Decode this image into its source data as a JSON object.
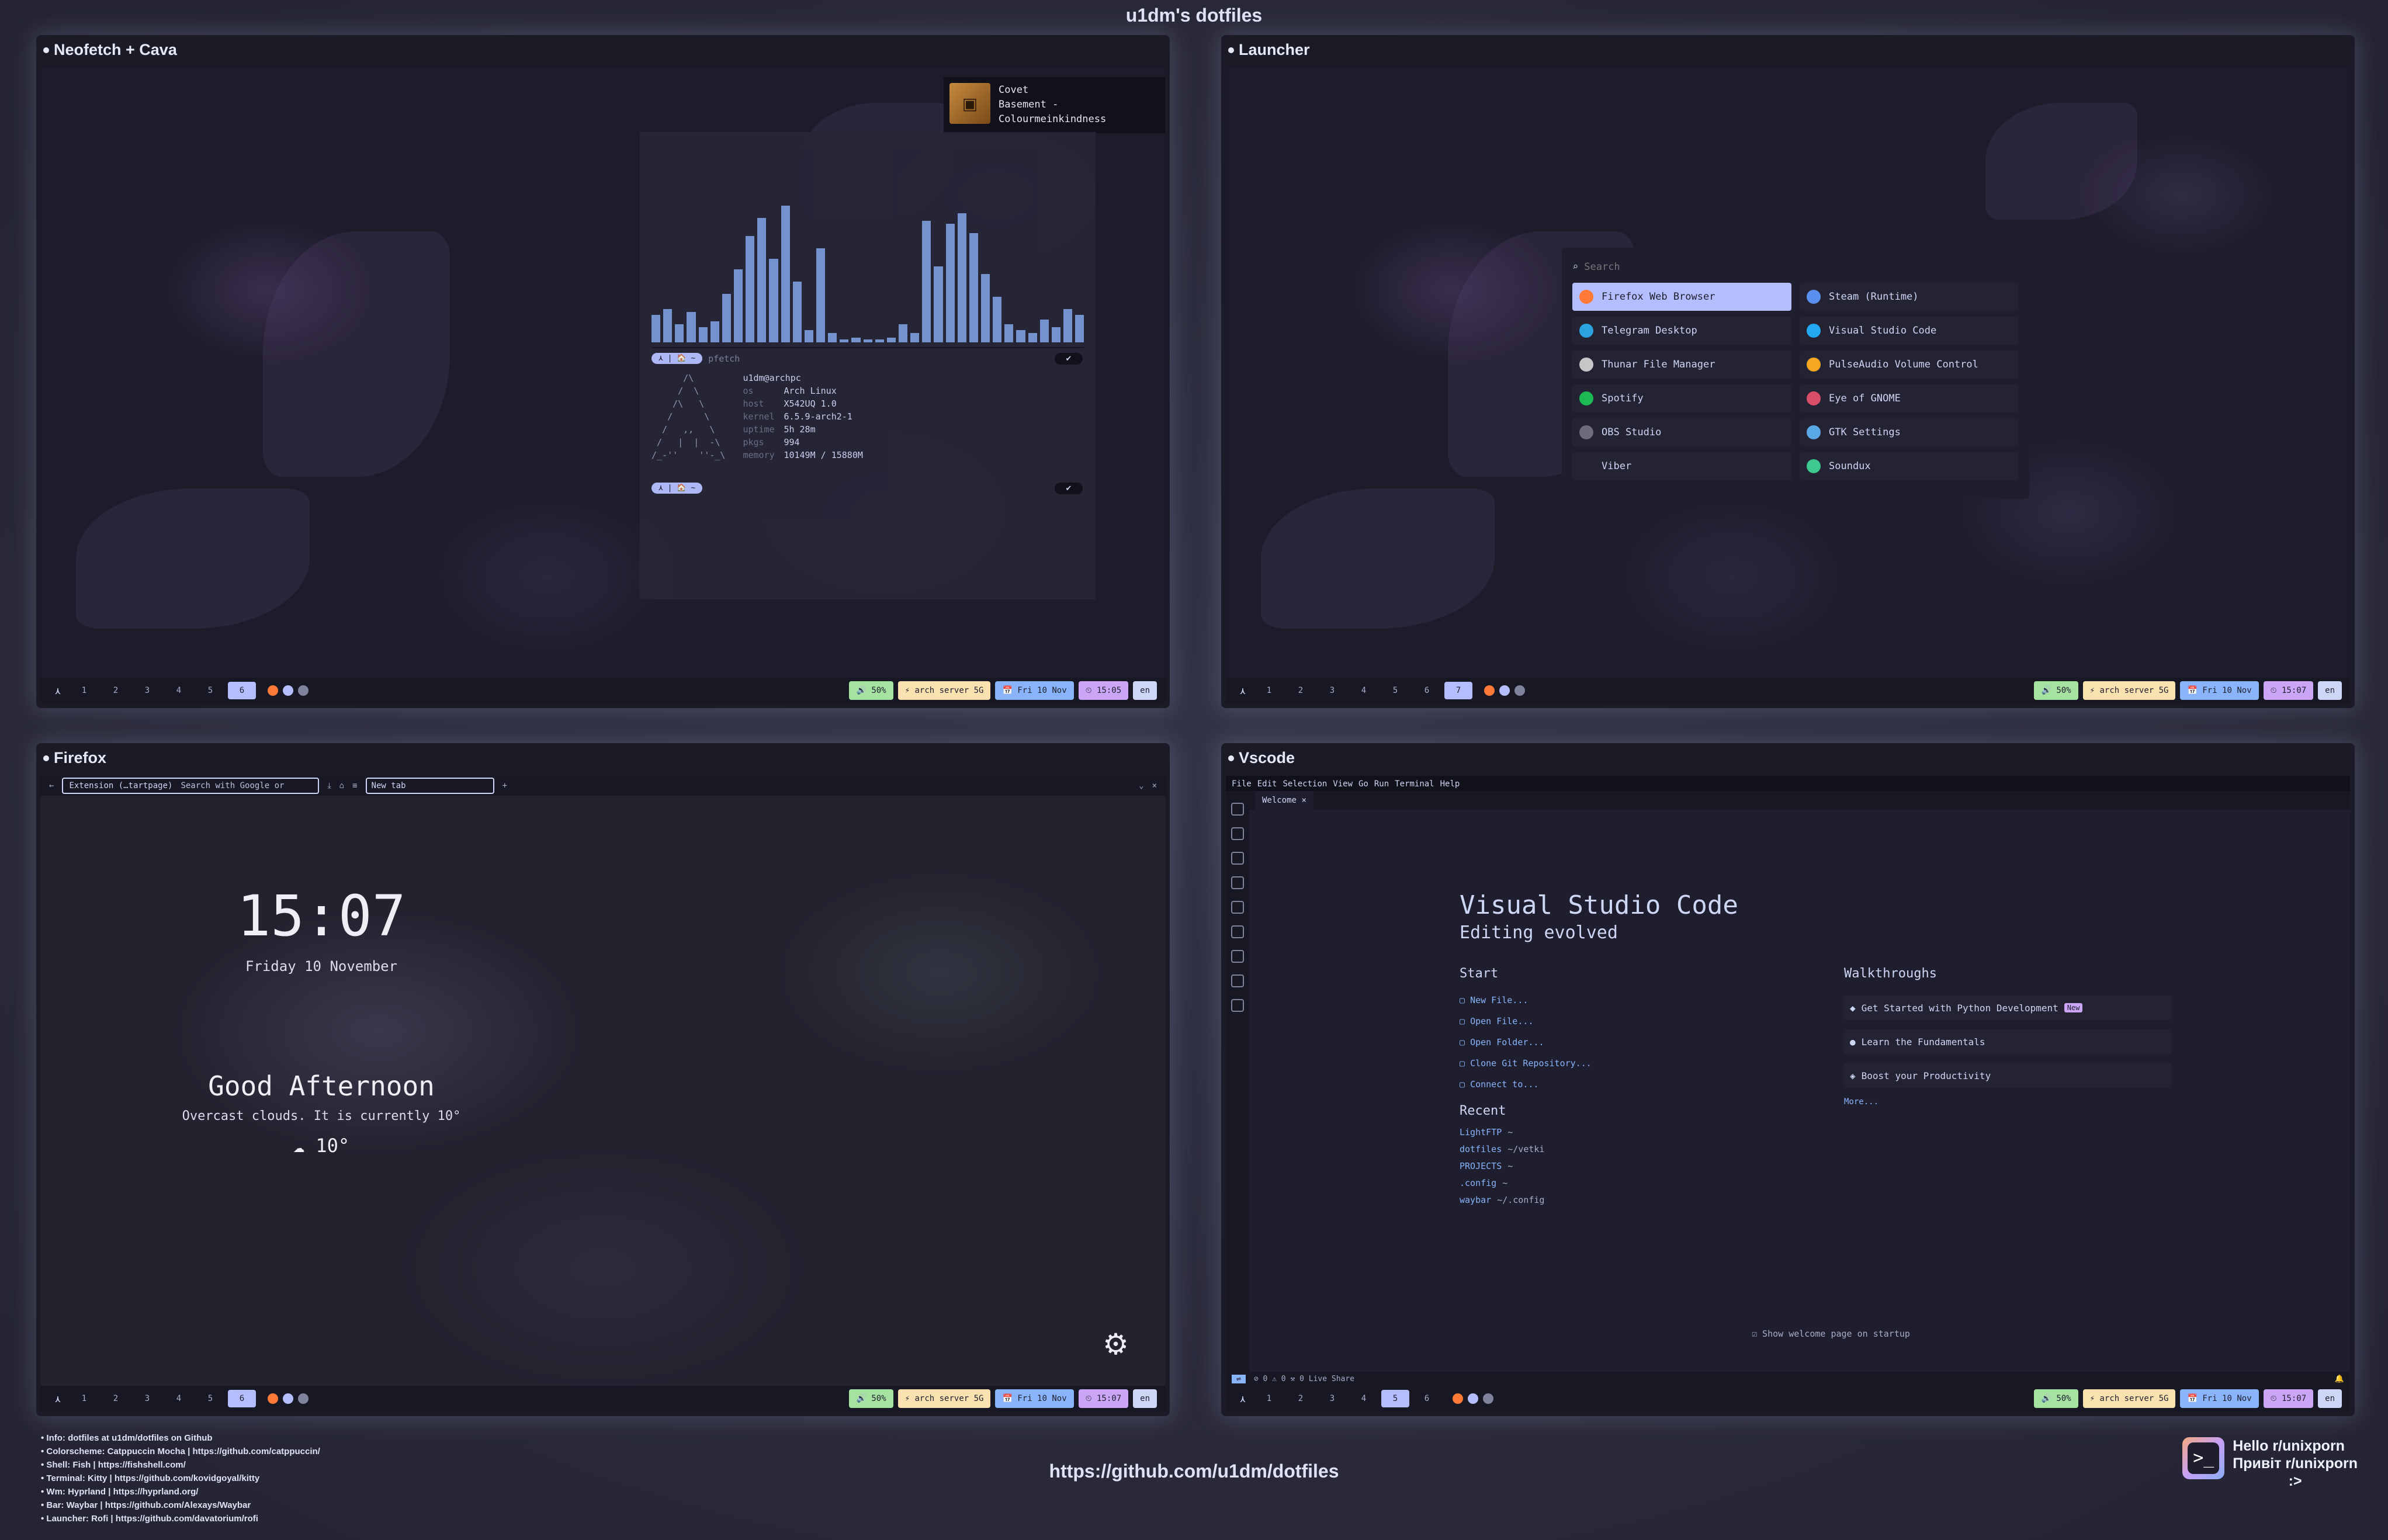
{
  "page_title": "u1dm's dotfiles",
  "bar": {
    "arch_glyph": "⋏",
    "workspaces": [
      "1",
      "2",
      "3",
      "4",
      "5"
    ],
    "ws6": "6",
    "ws7": "7",
    "volume": "🔊 50%",
    "network": "⚡ arch server 5G",
    "date": "📅 Fri 10 Nov",
    "lang": "en"
  },
  "panels": {
    "neofetch": {
      "title": "Neofetch + Cava",
      "clock": "⏲ 15:05",
      "now_playing": {
        "title": "Covet",
        "line2": "Basement -",
        "line3": "Colourmeinkindness"
      },
      "prompt_cmd": "pfetch",
      "prompt_seg": "⋏ | 🏠 ~",
      "check": "✔",
      "fetch": {
        "user": "u1dm@archpc",
        "os_label": "os",
        "os": "Arch Linux",
        "host_label": "host",
        "host": "X542UQ 1.0",
        "kernel_label": "kernel",
        "kernel": "6.5.9-arch2-1",
        "uptime_label": "uptime",
        "uptime": "5h 28m",
        "pkgs_label": "pkgs",
        "pkgs": "994",
        "memory_label": "memory",
        "memory": "10149M / 15880M"
      }
    },
    "launcher": {
      "title": "Launcher",
      "clock": "⏲ 15:07",
      "search_placeholder": "Search",
      "apps": [
        {
          "name": "Firefox Web Browser",
          "color": "#fe7a36"
        },
        {
          "name": "Steam (Runtime)",
          "color": "#5a8ff0"
        },
        {
          "name": "Telegram Desktop",
          "color": "#2aa3e0"
        },
        {
          "name": "Visual Studio Code",
          "color": "#23a9f2"
        },
        {
          "name": "Thunar File Manager",
          "color": "#c6c6c6"
        },
        {
          "name": "PulseAudio Volume Control",
          "color": "#f5a623"
        },
        {
          "name": "Spotify",
          "color": "#1db954"
        },
        {
          "name": "Eye of GNOME",
          "color": "#d94e6a"
        },
        {
          "name": "OBS Studio",
          "color": "#6c6c7c"
        },
        {
          "name": "GTK Settings",
          "color": "#5aa9e6"
        },
        {
          "name": "Viber",
          "color": "#232334"
        },
        {
          "name": "Soundux",
          "color": "#3ec98f"
        }
      ]
    },
    "firefox": {
      "title": "Firefox",
      "clock": "⏲ 15:07",
      "url_ext": "Extension (…tartpage)",
      "url_placeholder": "Search with Google or",
      "tab_label": "New tab",
      "time": "15:07",
      "date": "Friday 10 November",
      "greeting": "Good Afternoon",
      "weather": "Overcast clouds. It is currently 10°",
      "temp": "☁ 10°"
    },
    "vscode": {
      "title": "Vscode",
      "clock": "⏲ 15:07",
      "menu": [
        "File",
        "Edit",
        "Selection",
        "View",
        "Go",
        "Run",
        "Terminal",
        "Help"
      ],
      "tab": "Welcome",
      "h1": "Visual Studio Code",
      "h2": "Editing evolved",
      "start_title": "Start",
      "start": [
        "New File...",
        "Open File...",
        "Open Folder...",
        "Clone Git Repository...",
        "Connect to..."
      ],
      "recent_title": "Recent",
      "recent": [
        {
          "name": "LightFTP",
          "path": "~"
        },
        {
          "name": "dotfiles",
          "path": "~/vetki"
        },
        {
          "name": "PROJECTS",
          "path": "~"
        },
        {
          "name": ".config",
          "path": "~"
        },
        {
          "name": "waybar",
          "path": "~/.config"
        }
      ],
      "walk_title": "Walkthroughs",
      "walk": [
        "Get Started with Python Development",
        "Learn the Fundamentals",
        "Boost your Productivity"
      ],
      "walk_new": "New",
      "more": "More...",
      "show_welcome": "☑ Show welcome page on startup",
      "status": "⊘ 0 ⚠ 0   ⚒ 0   Live Share"
    }
  },
  "footer": {
    "info": [
      "Info: dotfiles at u1dm/dotfiles on Github",
      "Colorscheme: Catppuccin Mocha | https://github.com/catppuccin/",
      "Shell: Fish | https://fishshell.com/",
      "Terminal: Kitty | https://github.com/kovidgoyal/kitty",
      "Wm: Hyprland | https://hyprland.org/",
      "Bar: Waybar | https://github.com/Alexays/Waybar",
      "Launcher: Rofi | https://github.com/davatorium/rofi"
    ],
    "link": "https://github.com/u1dm/dotfiles",
    "hello1": "Hello r/unixporn",
    "hello2": "Привіт r/unixporn",
    "hello3": ":>"
  }
}
